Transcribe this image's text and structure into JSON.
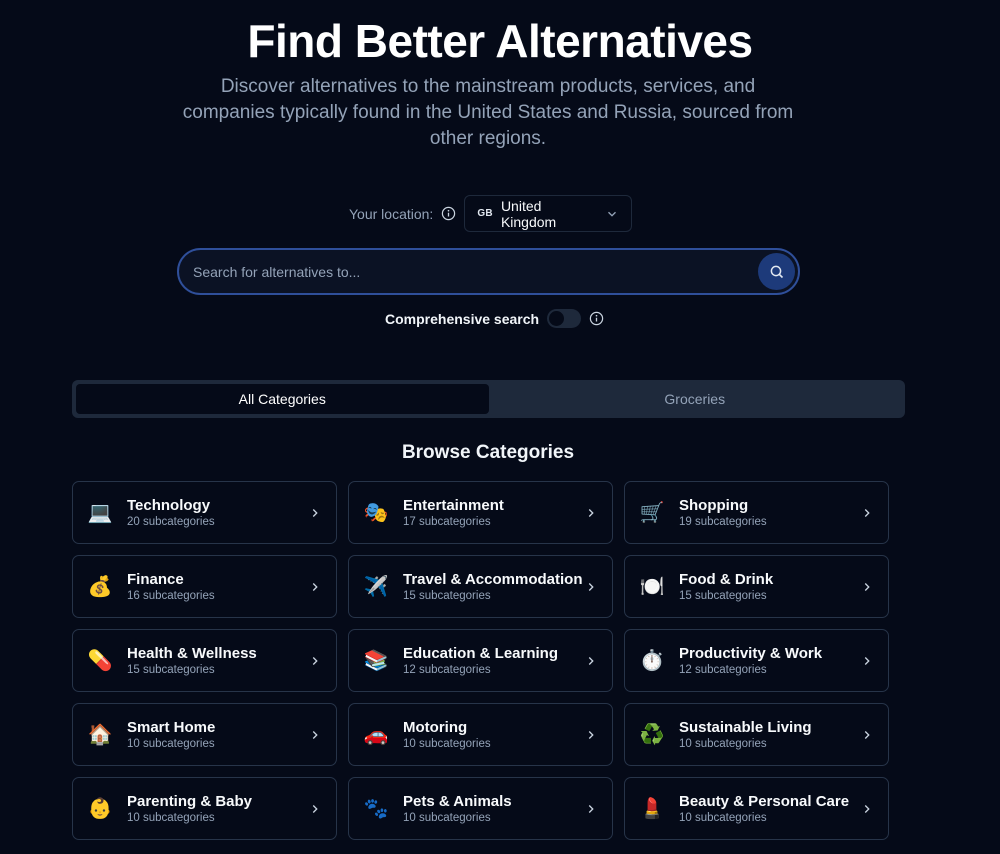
{
  "hero": {
    "title": "Find Better Alternatives",
    "subtitle": "Discover alternatives to the mainstream products, services, and companies typically found in the United States and Russia, sourced from other regions."
  },
  "location": {
    "label": "Your location:",
    "country_code": "GB",
    "country": "United Kingdom"
  },
  "search": {
    "placeholder": "Search for alternatives to..."
  },
  "comprehensive": {
    "label": "Comprehensive search",
    "enabled": false
  },
  "tabs": [
    {
      "label": "All Categories",
      "active": true
    },
    {
      "label": "Groceries",
      "active": false
    }
  ],
  "browse": {
    "title": "Browse Categories"
  },
  "categories": [
    {
      "emoji": "💻",
      "name": "Technology",
      "sub": "20 subcategories"
    },
    {
      "emoji": "🎭",
      "name": "Entertainment",
      "sub": "17 subcategories"
    },
    {
      "emoji": "🛒",
      "name": "Shopping",
      "sub": "19 subcategories"
    },
    {
      "emoji": "💰",
      "name": "Finance",
      "sub": "16 subcategories"
    },
    {
      "emoji": "✈️",
      "name": "Travel & Accommodation",
      "sub": "15 subcategories"
    },
    {
      "emoji": "🍽️",
      "name": "Food & Drink",
      "sub": "15 subcategories"
    },
    {
      "emoji": "💊",
      "name": "Health & Wellness",
      "sub": "15 subcategories"
    },
    {
      "emoji": "📚",
      "name": "Education & Learning",
      "sub": "12 subcategories"
    },
    {
      "emoji": "⏱️",
      "name": "Productivity & Work",
      "sub": "12 subcategories"
    },
    {
      "emoji": "🏠",
      "name": "Smart Home",
      "sub": "10 subcategories"
    },
    {
      "emoji": "🚗",
      "name": "Motoring",
      "sub": "10 subcategories"
    },
    {
      "emoji": "♻️",
      "name": "Sustainable Living",
      "sub": "10 subcategories"
    },
    {
      "emoji": "👶",
      "name": "Parenting & Baby",
      "sub": "10 subcategories"
    },
    {
      "emoji": "🐾",
      "name": "Pets & Animals",
      "sub": "10 subcategories"
    },
    {
      "emoji": "💄",
      "name": "Beauty & Personal Care",
      "sub": "10 subcategories"
    }
  ],
  "colors": {
    "background": "#050a18",
    "accent": "#1d3a7a",
    "border": "#273449"
  }
}
